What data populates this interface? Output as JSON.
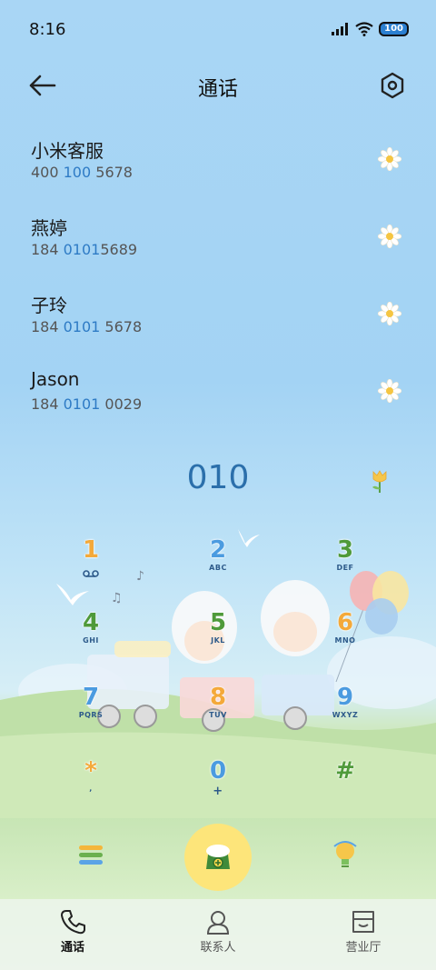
{
  "status_bar": {
    "time": "8:16",
    "battery": "100"
  },
  "header": {
    "title": "通话",
    "back_icon": "back-arrow-icon",
    "settings_icon": "settings-hexagon-icon"
  },
  "contacts": [
    {
      "name": "小米客服",
      "number_pre": "400 ",
      "number_match": "100",
      "number_post": " 5678"
    },
    {
      "name": "燕婷",
      "number_pre": "184 ",
      "number_match": "0101",
      "number_post": "5689"
    },
    {
      "name": "子玲",
      "number_pre": "184 ",
      "number_match": "0101",
      "number_post": " 5678"
    },
    {
      "name": "Jason",
      "number_pre": "184 ",
      "number_match": "0101",
      "number_post": " 0029"
    }
  ],
  "dial": {
    "input": "010"
  },
  "keypad": [
    {
      "digit": "1",
      "letters": "",
      "color": "orange"
    },
    {
      "digit": "2",
      "letters": "ABC",
      "color": "blue"
    },
    {
      "digit": "3",
      "letters": "DEF",
      "color": "green"
    },
    {
      "digit": "4",
      "letters": "GHI",
      "color": "green"
    },
    {
      "digit": "5",
      "letters": "JKL",
      "color": "green"
    },
    {
      "digit": "6",
      "letters": "MNO",
      "color": "orange"
    },
    {
      "digit": "7",
      "letters": "PQRS",
      "color": "blue"
    },
    {
      "digit": "8",
      "letters": "TUV",
      "color": "orange"
    },
    {
      "digit": "9",
      "letters": "WXYZ",
      "color": "blue"
    },
    {
      "digit": "*",
      "letters": ",",
      "color": "orange"
    },
    {
      "digit": "0",
      "letters": "+",
      "color": "blue"
    },
    {
      "digit": "#",
      "letters": "",
      "color": "green"
    }
  ],
  "actions": {
    "menu_icon": "menu-lines-icon",
    "call_icon": "call-phone-icon",
    "bulb_icon": "lightbulb-icon"
  },
  "bottom_nav": [
    {
      "label": "通话",
      "icon": "phone-icon",
      "active": true
    },
    {
      "label": "联系人",
      "icon": "contact-person-icon",
      "active": false
    },
    {
      "label": "营业厅",
      "icon": "store-icon",
      "active": false
    }
  ],
  "colors": {
    "accent": "#2e7bc5",
    "call_button": "#fde57a"
  }
}
